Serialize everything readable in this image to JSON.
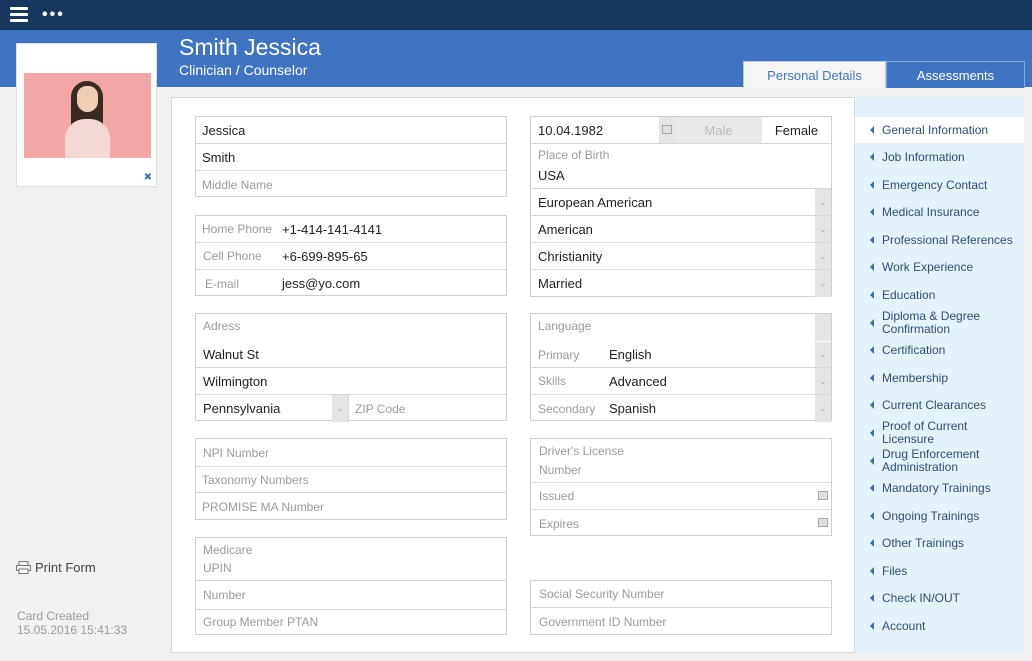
{
  "header": {
    "name": "Smith Jessica",
    "role": "Clinician / Counselor",
    "tabs": [
      {
        "label": "Personal Details",
        "active": true
      },
      {
        "label": "Assessments",
        "active": false
      }
    ]
  },
  "profile": {
    "remove_photo_icon": "✖",
    "print_form": "Print Form",
    "card_created_label": "Card Created",
    "card_created_value": "15.05.2016 15:41:33"
  },
  "name_fields": {
    "first_name": "Jessica",
    "last_name": "Smith",
    "middle_name_placeholder": "Middle Name"
  },
  "contact": {
    "home_phone_label": "Home Phone",
    "home_phone": "+1-414-141-4141",
    "cell_phone_label": "Cell Phone",
    "cell_phone": "+6-699-895-65",
    "email_label": "E-mail",
    "email": "jess@yo.com"
  },
  "address": {
    "label": "Adress",
    "street": "Walnut St",
    "city": "Wilmington",
    "state": "Pennsylvania",
    "zip_placeholder": "ZIP Code"
  },
  "ids": {
    "npi_placeholder": "NPI Number",
    "taxonomy_placeholder": "Taxonomy Numbers",
    "promise_placeholder": "PROMISE MA Number"
  },
  "medicare": {
    "label": "Medicare",
    "upin_placeholder": "UPIN",
    "number_placeholder": "Number",
    "ptan_placeholder": "Group Member PTAN"
  },
  "personal": {
    "birth_date": "10.04.1982",
    "gender_male": "Male",
    "gender_female": "Female",
    "place_of_birth_label": "Place of Birth",
    "place_of_birth": "USA",
    "ethnicity": "European American",
    "nationality": "American",
    "religion": "Christianity",
    "marital_status": "Married"
  },
  "language": {
    "label": "Language",
    "primary_label": "Primary",
    "primary": "English",
    "skills_label": "Skills",
    "skills": "Advanced",
    "secondary_label": "Secondary",
    "secondary": "Spanish"
  },
  "license": {
    "label": "Driver's License",
    "number_placeholder": "Number",
    "issued_placeholder": "Issued",
    "expires_placeholder": "Expires"
  },
  "govt": {
    "ssn_placeholder": "Social Security Number",
    "gov_id_placeholder": "Government ID Number"
  },
  "sidebar": {
    "items": [
      {
        "label": "General Information",
        "active": true
      },
      {
        "label": "Job Information"
      },
      {
        "label": "Emergency Contact"
      },
      {
        "label": "Medical Insurance"
      },
      {
        "label": "Professional References"
      },
      {
        "label": "Work Experience"
      },
      {
        "label": "Education"
      },
      {
        "label": "Diploma & Degree Confirmation"
      },
      {
        "label": "Certification"
      },
      {
        "label": "Membership"
      },
      {
        "label": "Current Clearances"
      },
      {
        "label": "Proof of Current Licensure"
      },
      {
        "label": "Drug Enforcement Administration"
      },
      {
        "label": "Mandatory Trainings"
      },
      {
        "label": "Ongoing Trainings"
      },
      {
        "label": "Other Trainings"
      },
      {
        "label": "Files"
      },
      {
        "label": "Check IN/OUT"
      },
      {
        "label": "Account"
      }
    ]
  }
}
